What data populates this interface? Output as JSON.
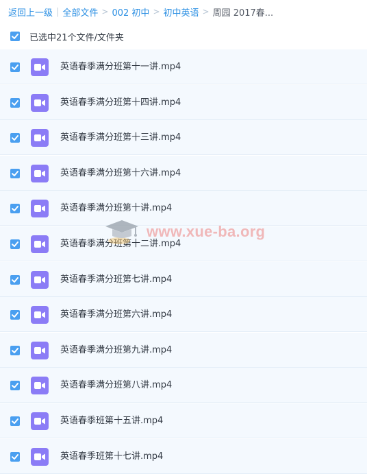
{
  "breadcrumb": {
    "back": "返回上一级",
    "separator_bar": "|",
    "separator_arrow": ">",
    "items": [
      "全部文件",
      "002 初中",
      "初中英语"
    ],
    "current": "周园 2017春..."
  },
  "selection": {
    "label": "已选中21个文件/文件夹",
    "checked": true
  },
  "files": [
    {
      "name": "英语春季满分班第十一讲.mp4",
      "checked": true,
      "icon": "video-file-icon"
    },
    {
      "name": "英语春季满分班第十四讲.mp4",
      "checked": true,
      "icon": "video-file-icon"
    },
    {
      "name": "英语春季满分班第十三讲.mp4",
      "checked": true,
      "icon": "video-file-icon"
    },
    {
      "name": "英语春季满分班第十六讲.mp4",
      "checked": true,
      "icon": "video-file-icon"
    },
    {
      "name": "英语春季满分班第十讲.mp4",
      "checked": true,
      "icon": "video-file-icon"
    },
    {
      "name": "英语春季满分班第十二讲.mp4",
      "checked": true,
      "icon": "video-file-icon"
    },
    {
      "name": "英语春季满分班第七讲.mp4",
      "checked": true,
      "icon": "video-file-icon"
    },
    {
      "name": "英语春季满分班第六讲.mp4",
      "checked": true,
      "icon": "video-file-icon"
    },
    {
      "name": "英语春季满分班第九讲.mp4",
      "checked": true,
      "icon": "video-file-icon"
    },
    {
      "name": "英语春季满分班第八讲.mp4",
      "checked": true,
      "icon": "video-file-icon"
    },
    {
      "name": "英语春季班第十五讲.mp4",
      "checked": true,
      "icon": "video-file-icon"
    },
    {
      "name": "英语春季班第十七讲.mp4",
      "checked": true,
      "icon": "video-file-icon"
    }
  ],
  "watermark": {
    "text": "www.xue-ba.org",
    "icon": "graduation-cap-icon"
  },
  "colors": {
    "link": "#2b8fe3",
    "checkbox": "#4a9ff0",
    "row_background": "#f4f9fe",
    "video_icon": "#8b7cf6",
    "watermark": "#f0a6a6"
  }
}
